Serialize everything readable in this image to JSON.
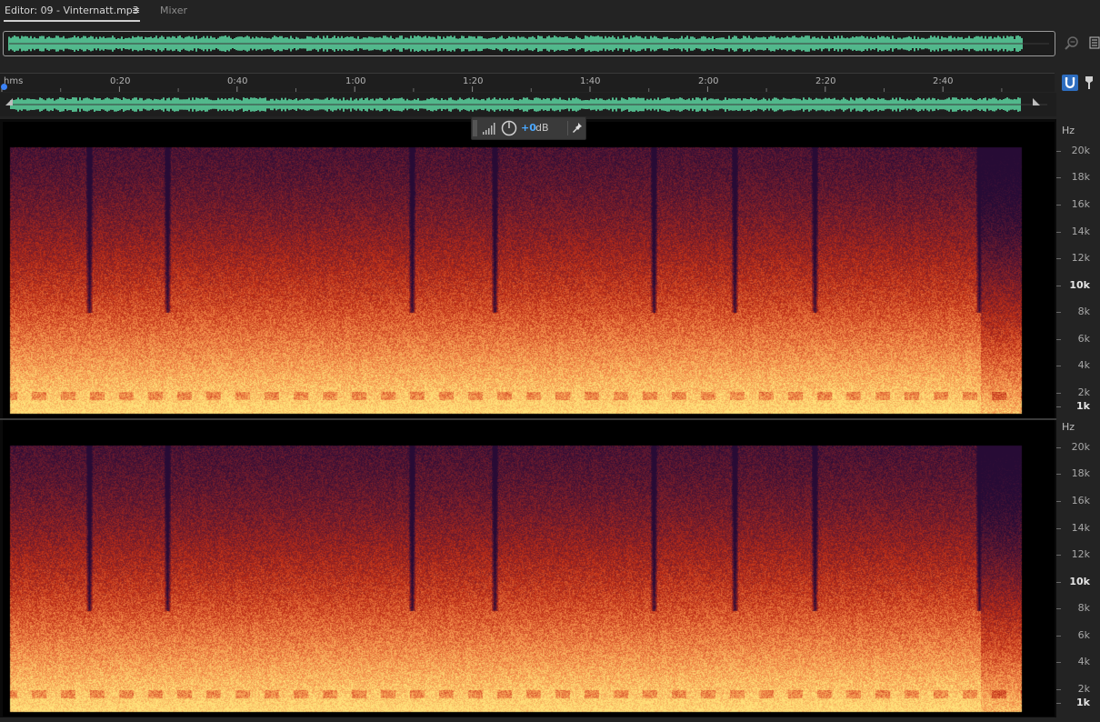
{
  "tabs": {
    "editor_label": "Editor: 09 - Vinternatt.mp3",
    "menu_glyph": "≡",
    "mixer_label": "Mixer"
  },
  "ruler": {
    "units_label": "hms",
    "labels": [
      "0:20",
      "0:40",
      "1:00",
      "1:20",
      "1:40",
      "2:00",
      "2:20",
      "2:40"
    ]
  },
  "hud": {
    "gain_value": "+0",
    "gain_unit": "dB"
  },
  "frequency_scale": {
    "unit": "Hz",
    "channel_1": [
      "20k",
      "18k",
      "16k",
      "14k",
      "12k",
      "10k",
      "8k",
      "6k",
      "4k",
      "2k",
      "1k"
    ],
    "channel_2": [
      "20k",
      "18k",
      "16k",
      "14k",
      "12k",
      "10k",
      "8k",
      "6k",
      "4k",
      "2k",
      "1k"
    ],
    "bold_labels": [
      "10k",
      "1k"
    ]
  },
  "colors": {
    "waveform": "#5fe0a8",
    "accent": "#2d6dbf",
    "gain_text": "#4aa8ff",
    "spectrogram_low": "#ffe27a",
    "spectrogram_mid": "#e8361a",
    "spectrogram_high": "#5a1a7a"
  },
  "icons": {
    "zoom": "zoom-icon",
    "panel_menu": "list-icon",
    "snap": "magnet-icon",
    "marker": "marker-icon",
    "gain_knob": "knob-icon",
    "pin": "pin-icon"
  }
}
